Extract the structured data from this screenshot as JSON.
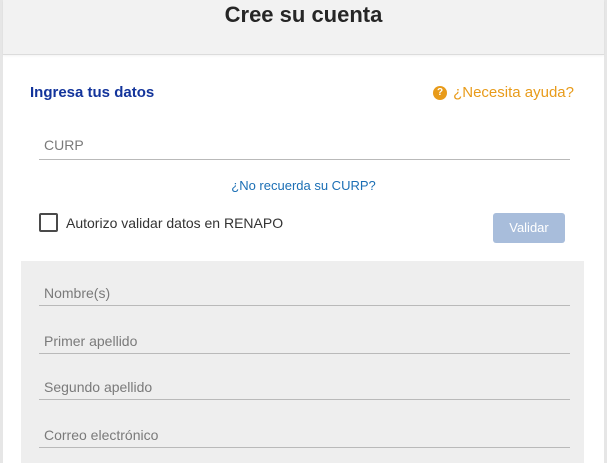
{
  "header": {
    "title": "Cree su cuenta"
  },
  "section": {
    "title": "Ingresa tus datos"
  },
  "help": {
    "label": "¿Necesita ayuda?",
    "icon": "question-circle-icon",
    "icon_glyph": "?",
    "color": "#e89b1a"
  },
  "curp": {
    "placeholder": "CURP",
    "value": "",
    "forgot_link": "¿No recuerda su CURP?"
  },
  "consent": {
    "checked": false,
    "label": "Autorizo validar datos en RENAPO"
  },
  "validate_button": {
    "label": "Validar",
    "enabled": false,
    "color": "#a8bddb"
  },
  "personal_fields": [
    {
      "placeholder": "Nombre(s)",
      "value": ""
    },
    {
      "placeholder": "Primer apellido",
      "value": ""
    },
    {
      "placeholder": "Segundo apellido",
      "value": ""
    },
    {
      "placeholder": "Correo electrónico",
      "value": ""
    }
  ],
  "colors": {
    "section_title": "#13349b",
    "link": "#1b6fb5",
    "panel_background": "#eeeeee",
    "header_background": "#f2f2f2"
  }
}
